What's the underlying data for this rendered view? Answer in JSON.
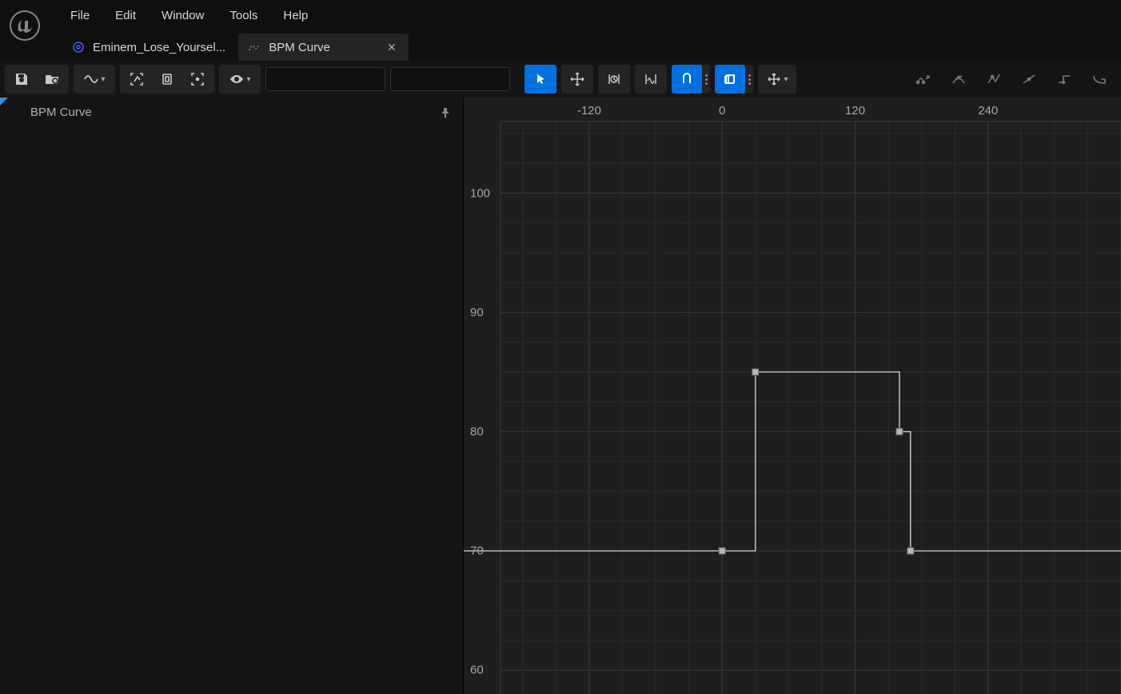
{
  "menu": {
    "items": [
      "File",
      "Edit",
      "Window",
      "Tools",
      "Help"
    ]
  },
  "tabs": [
    {
      "label": "Eminem_Lose_Yoursel...",
      "active": false
    },
    {
      "label": "BPM Curve",
      "active": true
    }
  ],
  "sidepanel": {
    "curve_name": "BPM Curve"
  },
  "toolbar": {
    "input1": "",
    "input2": ""
  },
  "chart_data": {
    "type": "line",
    "interpolation": "step",
    "xlabel": "",
    "ylabel": "",
    "x_ticks": [
      -120,
      0,
      120,
      240
    ],
    "y_ticks": [
      60,
      70,
      80,
      90,
      100
    ],
    "x_range": [
      -200,
      360
    ],
    "y_range": [
      58,
      106
    ],
    "keys": [
      {
        "x": 0,
        "y": 70
      },
      {
        "x": 30,
        "y": 85
      },
      {
        "x": 160,
        "y": 80
      },
      {
        "x": 170,
        "y": 70
      }
    ]
  }
}
